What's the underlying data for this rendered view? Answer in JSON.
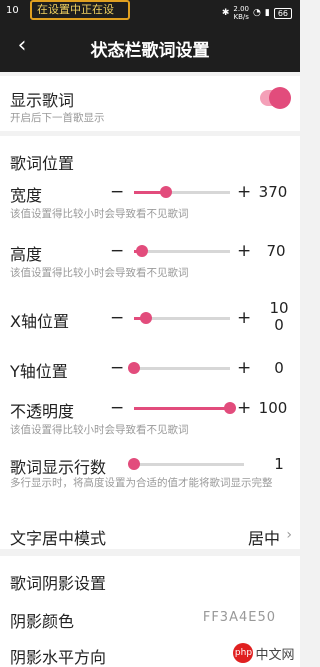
{
  "status_bar": {
    "time": "10",
    "ticker": "在设置中正在设",
    "network_speed": "2.00",
    "network_unit": "KB/s",
    "battery": "66"
  },
  "header": {
    "title": "状态栏歌词设置"
  },
  "display": {
    "title": "显示歌词",
    "subtitle": "开启后下一首歌显示",
    "enabled": true
  },
  "position_section": {
    "title": "歌词位置",
    "sliders": [
      {
        "label": "宽度",
        "value": "370",
        "fraction": 0.33,
        "hint": "该值设置得比较小时会导致看不见歌词"
      },
      {
        "label": "高度",
        "value": "70",
        "fraction": 0.08,
        "hint": "该值设置得比较小时会导致看不见歌词"
      },
      {
        "label": "X轴位置",
        "value": "100",
        "fraction": 0.13,
        "hint": ""
      },
      {
        "label": "Y轴位置",
        "value": "0",
        "fraction": 0.0,
        "hint": ""
      },
      {
        "label": "不透明度",
        "value": "100",
        "fraction": 1.0,
        "hint": "该值设置得比较小时会导致看不见歌词"
      }
    ],
    "lines": {
      "label": "歌词显示行数",
      "value": "1",
      "fraction": 0.0,
      "hint": "多行显示时，将高度设置为合适的值才能将歌词显示完整"
    },
    "center_mode": {
      "label": "文字居中模式",
      "value": "居中"
    }
  },
  "shadow_section": {
    "title": "歌词阴影设置",
    "color": {
      "label": "阴影颜色",
      "value": "FF3A4E50"
    },
    "horizontal": {
      "label": "阴影水平方向"
    }
  },
  "watermark": {
    "badge": "php",
    "text": "中文网"
  }
}
